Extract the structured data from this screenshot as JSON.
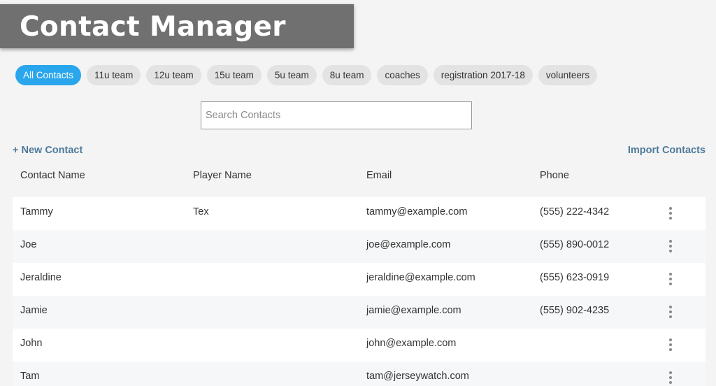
{
  "app": {
    "title": "Contact Manager"
  },
  "tags": [
    {
      "label": "All Contacts",
      "active": true
    },
    {
      "label": "11u team",
      "active": false
    },
    {
      "label": "12u team",
      "active": false
    },
    {
      "label": "15u team",
      "active": false
    },
    {
      "label": "5u team",
      "active": false
    },
    {
      "label": "8u team",
      "active": false
    },
    {
      "label": "coaches",
      "active": false
    },
    {
      "label": "registration 2017-18",
      "active": false
    },
    {
      "label": "volunteers",
      "active": false
    }
  ],
  "search": {
    "placeholder": "Search Contacts",
    "value": ""
  },
  "actions": {
    "new_contact": "+ New Contact",
    "import_contacts": "Import Contacts"
  },
  "table": {
    "columns": [
      "Contact Name",
      "Player Name",
      "Email",
      "Phone"
    ],
    "rows": [
      {
        "contact": "Tammy",
        "player": "Tex",
        "email": "tammy@example.com",
        "phone": "(555) 222-4342"
      },
      {
        "contact": "Joe",
        "player": "",
        "email": "joe@example.com",
        "phone": "(555) 890-0012"
      },
      {
        "contact": "Jeraldine",
        "player": "",
        "email": "jeraldine@example.com",
        "phone": "(555) 623-0919"
      },
      {
        "contact": "Jamie",
        "player": "",
        "email": "jamie@example.com",
        "phone": "(555) 902-4235"
      },
      {
        "contact": "John",
        "player": "",
        "email": "john@example.com",
        "phone": ""
      },
      {
        "contact": "Tam",
        "player": "",
        "email": "tam@jerseywatch.com",
        "phone": ""
      }
    ]
  },
  "icons": {
    "row_menu": "more-vertical-icon"
  },
  "colors": {
    "accent": "#2aa6ec",
    "link": "#4d7a9c",
    "title_bar": "#707070"
  }
}
